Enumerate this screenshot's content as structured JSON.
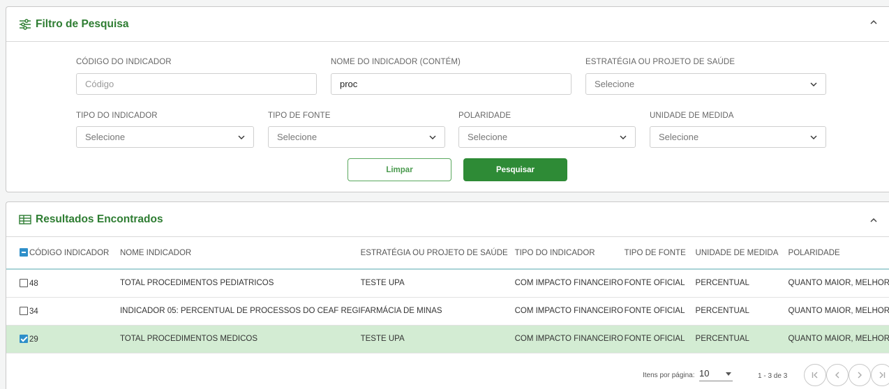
{
  "filter": {
    "title": "Filtro de Pesquisa",
    "fields": {
      "codigo": {
        "label": "CÓDIGO DO INDICADOR",
        "placeholder": "Código",
        "value": ""
      },
      "nome": {
        "label": "NOME DO INDICADOR (CONTÉM)",
        "value": "proc"
      },
      "estrategia": {
        "label": "ESTRATÉGIA OU PROJETO DE SAÚDE",
        "value": "Selecione"
      },
      "tipo_indicador": {
        "label": "TIPO DO INDICADOR",
        "value": "Selecione"
      },
      "tipo_fonte": {
        "label": "TIPO DE FONTE",
        "value": "Selecione"
      },
      "polaridade": {
        "label": "POLARIDADE",
        "value": "Selecione"
      },
      "unidade": {
        "label": "UNIDADE DE MEDIDA",
        "value": "Selecione"
      }
    },
    "buttons": {
      "clear": "Limpar",
      "search": "Pesquisar"
    }
  },
  "results": {
    "title": "Resultados Encontrados",
    "columns": [
      "CÓDIGO INDICADOR",
      "NOME INDICADOR",
      "ESTRATÉGIA OU PROJETO DE SAÚDE",
      "TIPO DO INDICADOR",
      "TIPO DE FONTE",
      "UNIDADE DE MEDIDA",
      "POLARIDADE"
    ],
    "rows": [
      {
        "checked": false,
        "codigo": "48",
        "nome": "TOTAL PROCEDIMENTOS PEDIATRICOS",
        "estrategia": "TESTE UPA",
        "tipo": "COM IMPACTO FINANCEIRO",
        "fonte": "FONTE OFICIAL",
        "unidade": "PERCENTUAL",
        "polaridade": "QUANTO MAIOR, MELHOR"
      },
      {
        "checked": false,
        "codigo": "34",
        "nome": "INDICADOR 05: PERCENTUAL DE PROCESSOS DO CEAF REGI",
        "estrategia": "FARMÁCIA DE MINAS",
        "tipo": "COM IMPACTO FINANCEIRO",
        "fonte": "FONTE OFICIAL",
        "unidade": "PERCENTUAL",
        "polaridade": "QUANTO MAIOR, MELHOR"
      },
      {
        "checked": true,
        "codigo": "29",
        "nome": "TOTAL PROCEDIMENTOS MEDICOS",
        "estrategia": "TESTE UPA",
        "tipo": "COM IMPACTO FINANCEIRO",
        "fonte": "FONTE OFICIAL",
        "unidade": "PERCENTUAL",
        "polaridade": "QUANTO MAIOR, MELHOR"
      }
    ],
    "paginator": {
      "items_per_page_label": "Itens por página:",
      "items_per_page": "10",
      "range": "1 - 3 de 3"
    }
  },
  "colors": {
    "green": "#2e7d32",
    "button_green": "#2e8b36",
    "selected_row": "#d3ecd3",
    "checkbox_blue": "#2e8fc9"
  }
}
